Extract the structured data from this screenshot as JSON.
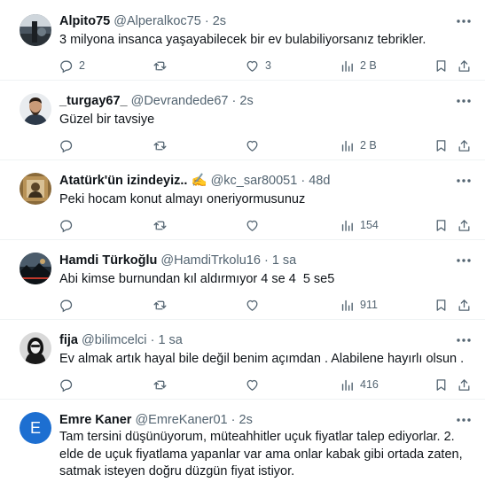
{
  "replies": [
    {
      "name": "Alpito75",
      "handle": "@Alperalkoc75",
      "sep": "·",
      "time": "2s",
      "text": "3 milyona insanca yaşayabilecek bir ev bulabiliyorsanız tebrikler.",
      "reply_count": "2",
      "retweet_count": "",
      "like_count": "3",
      "views": "2 B"
    },
    {
      "name": "_turgay67_",
      "handle": "@Devrandede67",
      "sep": "·",
      "time": "2s",
      "text": "Güzel bir tavsiye",
      "reply_count": "",
      "retweet_count": "",
      "like_count": "",
      "views": "2 B"
    },
    {
      "name": "Atatürk'ün izindeyiz..",
      "name_emoji": "✍",
      "handle": "@kc_sar80051",
      "sep": "·",
      "time": "48d",
      "text": "Peki hocam konut almayı oneriyormusunuz",
      "reply_count": "",
      "retweet_count": "",
      "like_count": "",
      "views": "154"
    },
    {
      "name": "Hamdi Türkoğlu",
      "handle": "@HamdiTrkolu16",
      "sep": "·",
      "time": "1 sa",
      "text": "Abi kimse burnundan kıl aldırmıyor 4 se 4  5 se5",
      "reply_count": "",
      "retweet_count": "",
      "like_count": "",
      "views": "911"
    },
    {
      "name": "fija",
      "handle": "@bilimcelci",
      "sep": "·",
      "time": "1 sa",
      "text": "Ev almak artık hayal bile değil benim açımdan . Alabilene hayırlı olsun .",
      "reply_count": "",
      "retweet_count": "",
      "like_count": "",
      "views": "416"
    },
    {
      "name": "Emre Kaner",
      "handle": "@EmreKaner01",
      "sep": "·",
      "time": "2s",
      "avatar_letter": "E",
      "text": "Tam tersini düşünüyorum, müteahhitler uçuk fiyatlar talep ediyorlar. 2. elde de uçuk fiyatlama yapanlar var ama onlar kabak gibi ortada zaten, satmak isteyen doğru düzgün fiyat istiyor."
    }
  ],
  "icons": {
    "more": "more-horizontal-icon",
    "reply": "reply-bubble-icon",
    "retweet": "retweet-icon",
    "like": "heart-icon",
    "views": "views-bar-chart-icon",
    "bookmark": "bookmark-icon",
    "share": "share-upload-icon"
  },
  "colors": {
    "text": "#0f1419",
    "muted": "#536471",
    "divider": "#eff3f4",
    "avatar_blue": "#1d6fd1"
  }
}
